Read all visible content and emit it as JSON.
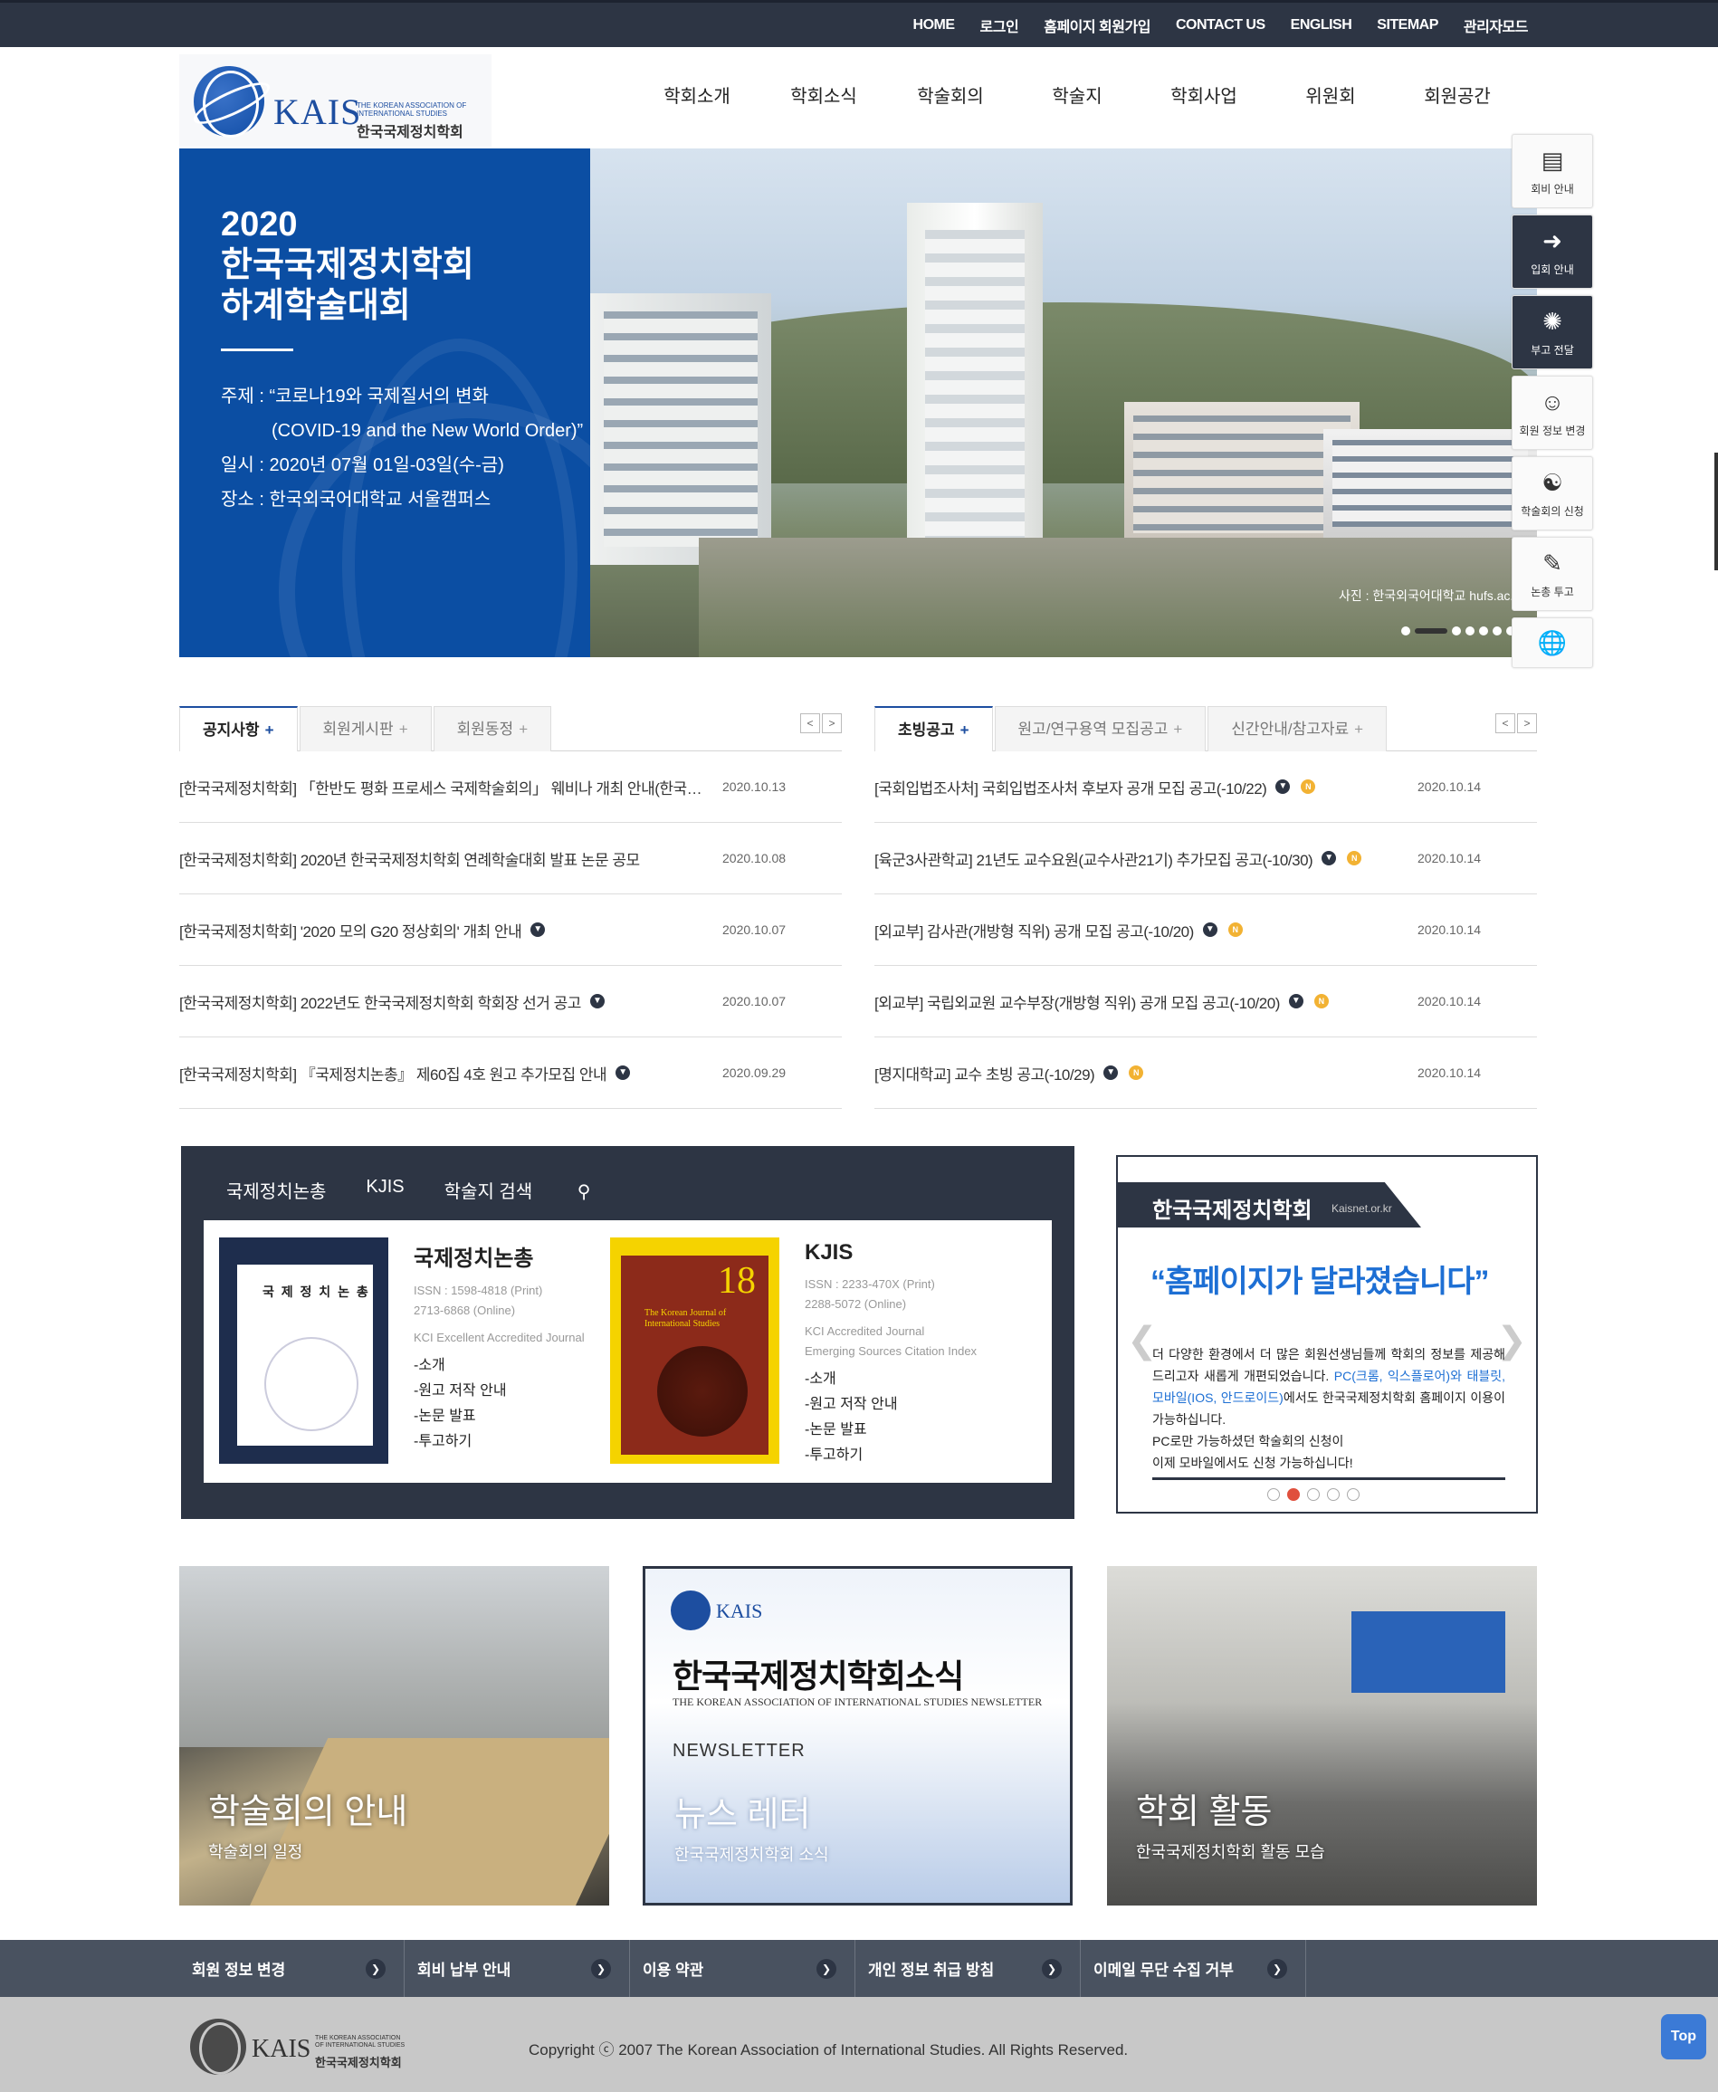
{
  "topbar": {
    "links": [
      "HOME",
      "로그인",
      "홈페이지 회원가입",
      "CONTACT US",
      "ENGLISH",
      "SITEMAP",
      "관리자모드"
    ]
  },
  "logo": {
    "abbr": "KAIS",
    "sub": "THE KOREAN ASSOCIATION OF INTERNATIONAL STUDIES",
    "kor": "한국국제정치학회"
  },
  "gnb": [
    "학회소개",
    "학회소식",
    "학술회의",
    "학술지",
    "학회사업",
    "위원회",
    "회원공간"
  ],
  "hero": {
    "title": "2020\n한국국제정치학회\n하계학술대회",
    "theme_label": "주제 : “코로나19와 국제질서의 변화",
    "theme_en": "(COVID-19 and the New World Order)”",
    "date": "일시 : 2020년 07월 01일-03일(수-금)",
    "place": "장소 : 한국외국어대학교 서울캠퍼스",
    "caption": "사진 : 한국외국어대학교 hufs.ac.kr"
  },
  "quick": [
    {
      "label": "회비 안내",
      "icon": "bank-card-icon"
    },
    {
      "label": "입회 안내",
      "icon": "login-arrow-icon"
    },
    {
      "label": "부고 전달",
      "icon": "chrysanthemum-icon"
    },
    {
      "label": "회원 정보 변경",
      "icon": "user-info-icon"
    },
    {
      "label": "학술회의 신청",
      "icon": "conference-people-icon"
    },
    {
      "label": "논총 투고",
      "icon": "journal-submit-icon"
    }
  ],
  "notice": {
    "tabs": [
      "공지사항",
      "회원게시판",
      "회원동정"
    ],
    "items": [
      {
        "title": "[한국국제정치학회] 「한반도 평화 프로세스 국제학술회의」 웨비나 개최 안내(한국어·영어) 개최",
        "date": "2020.10.13"
      },
      {
        "title": "[한국국제정치학회] 2020년 한국국제정치학회 연례학술대회 발표 논문 공모",
        "date": "2020.10.08"
      },
      {
        "title": "[한국국제정치학회] '2020 모의 G20 정상회의' 개최 안내",
        "date": "2020.10.07"
      },
      {
        "title": "[한국국제정치학회] 2022년도 한국국제정치학회 학회장 선거 공고",
        "date": "2020.10.07"
      },
      {
        "title": "[한국국제정치학회] 『국제정치논총』 제60집 4호 원고 추가모집 안내",
        "date": "2020.09.29"
      }
    ]
  },
  "recruit": {
    "tabs": [
      "초빙공고",
      "원고/연구용역 모집공고",
      "신간안내/참고자료"
    ],
    "items": [
      {
        "title": "[국회입법조사처] 국회입법조사처 후보자 공개 모집 공고(-10/22)",
        "date": "2020.10.14"
      },
      {
        "title": "[육군3사관학교] 21년도 교수요원(교수사관21기) 추가모집 공고(-10/30)",
        "date": "2020.10.14"
      },
      {
        "title": "[외교부] 감사관(개방형 직위) 공개 모집 공고(-10/20)",
        "date": "2020.10.14"
      },
      {
        "title": "[외교부] 국립외교원 교수부장(개방형 직위) 공개 모집 공고(-10/20)",
        "date": "2020.10.14"
      },
      {
        "title": "[명지대학교] 교수 초빙 공고(-10/29)",
        "date": "2020.10.14"
      }
    ]
  },
  "journal": {
    "tabs": [
      "국제정치논총",
      "KJIS",
      "학술지 검색"
    ],
    "j1": {
      "name": "국제정치논총",
      "cover": "국 제 정 치 논 총",
      "issn1": "ISSN : 1598-4818 (Print)",
      "issn2": "2713-6868 (Online)",
      "acc": "KCI Excellent Accredited Journal",
      "links": [
        "-소개",
        "-원고 저작 안내",
        "-논문 발표",
        "-투고하기"
      ]
    },
    "j2": {
      "name": "KJIS",
      "cover_num": "18",
      "cover_title": "The Korean Journal of International Studies",
      "issn1": "ISSN : 2233-470X (Print)",
      "issn2": "2288-5072 (Online)",
      "acc1": "KCI Accredited Journal",
      "acc2": "Emerging Sources Citation Index",
      "links": [
        "-소개",
        "-원고 저작 안내",
        "-논문 발표",
        "-투고하기"
      ]
    }
  },
  "popup": {
    "name": "한국국제정치학회",
    "url": "Kaisnet.or.kr",
    "headline": "“홈페이지가 달라졌습니다”",
    "body1": "더 다양한 환경에서 더 많은 회원선생님들께 학회의 정보를 제공해드리고자 새롭게 개편되었습니다.",
    "body_hl": "PC(크롬, 익스플로어)와 태블릿, 모바일(IOS, 안드로이드)",
    "body2": "에서도 한국국제정치학회 홈페이지 이용이 가능하십니다.",
    "body3": "PC로만 가능하셨던 학술회의 신청이",
    "body4": "이제 모바일에서도 신청 가능하십니다!"
  },
  "cards": [
    {
      "title": "학술회의 안내",
      "sub": "학술회의 일정"
    },
    {
      "title": "뉴스 레터",
      "sub": "한국국제정치학회 소식",
      "k": "한국국제정치학회소식",
      "ke": "THE KOREAN ASSOCIATION OF INTERNATIONAL STUDIES NEWSLETTER",
      "nl": "NEWSLETTER",
      "abbr": "KAIS"
    },
    {
      "title": "학회 활동",
      "sub": "한국국제정치학회 활동 모습"
    }
  ],
  "footer_links": [
    "회원 정보 변경",
    "회비 납부 안내",
    "이용 약관",
    "개인 정보 취급 방침",
    "이메일 무단 수집 거부"
  ],
  "footer": {
    "abbr": "KAIS",
    "sub": "THE KOREAN ASSOCIATION OF INTERNATIONAL STUDIES",
    "kor": "한국국제정치학회",
    "copy": "Copyright ⓒ 2007 The Korean Association of International Studies. All Rights Reserved."
  },
  "top_label": "Top"
}
